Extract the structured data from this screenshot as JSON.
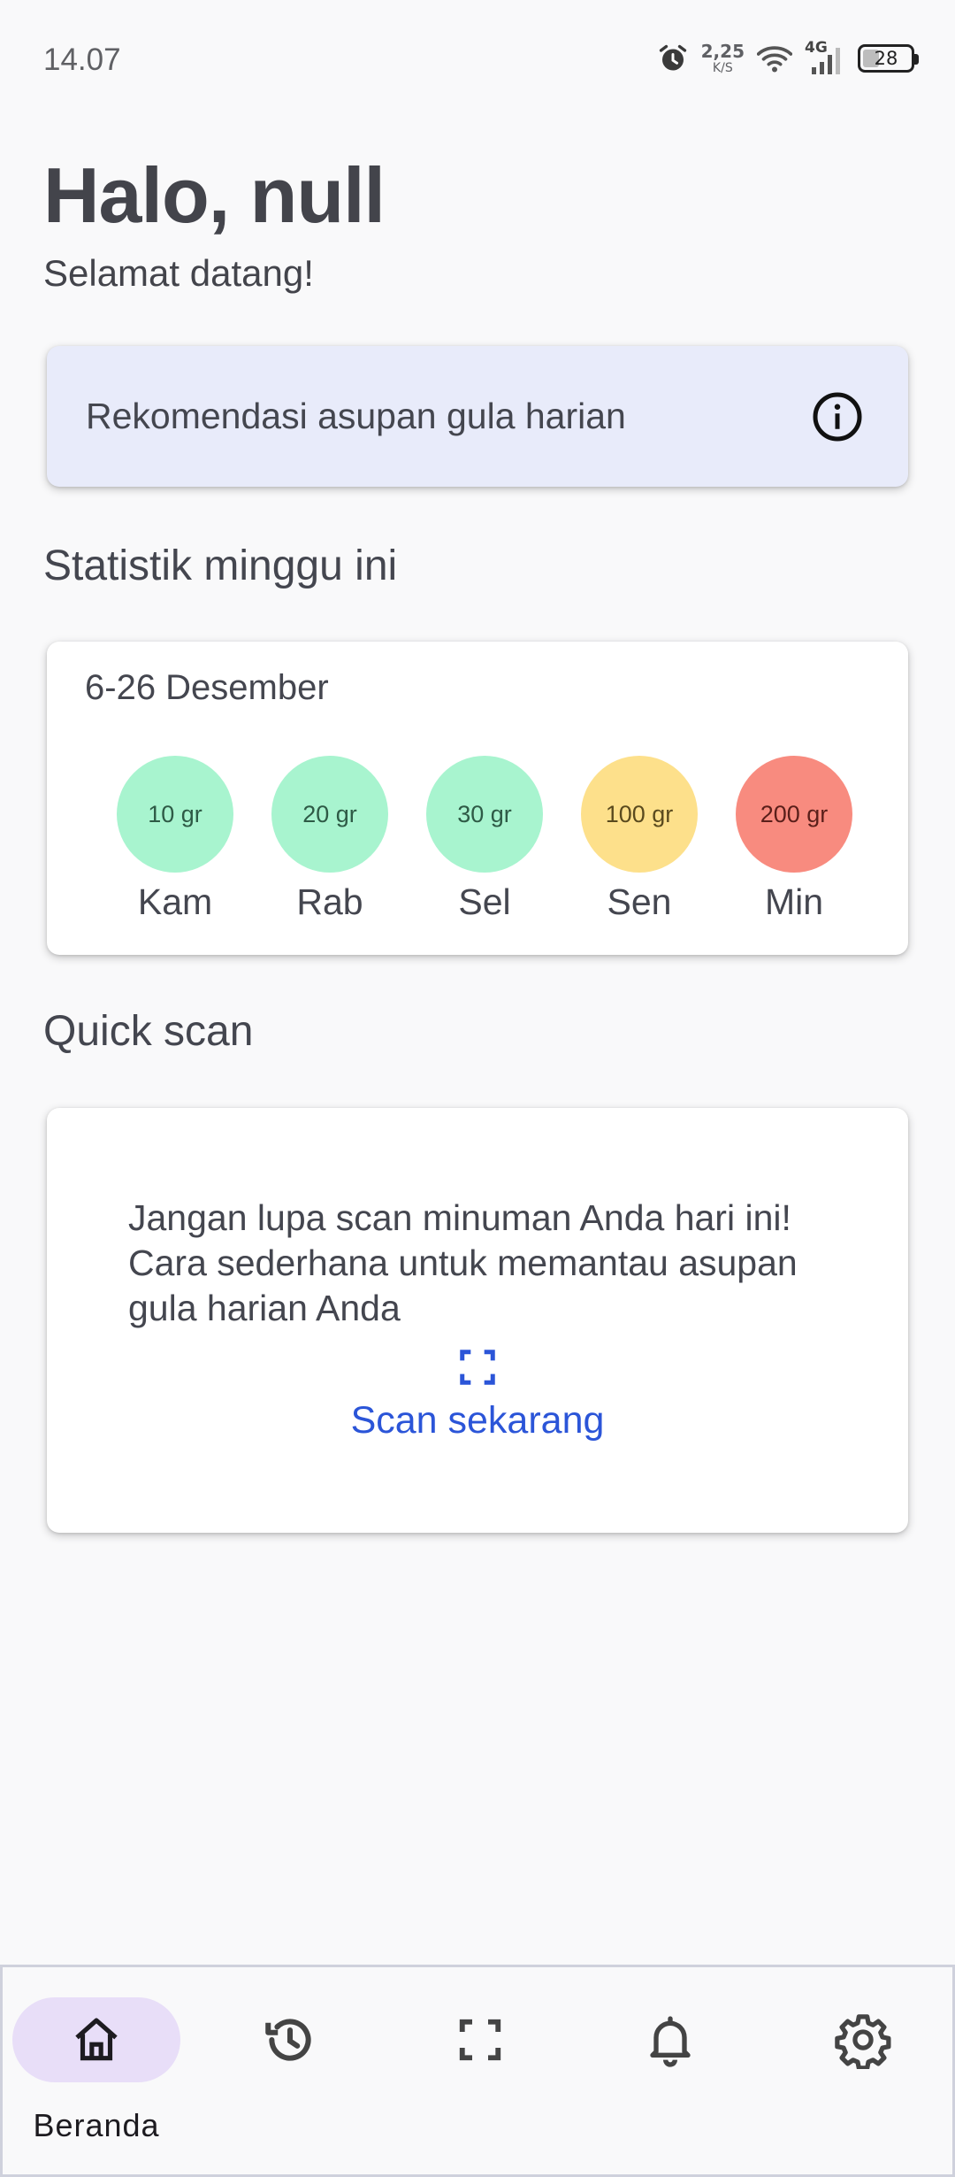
{
  "status_bar": {
    "time": "14.07",
    "speed_value": "2,25",
    "speed_unit": "K/S",
    "network": "4G",
    "battery": "28"
  },
  "header": {
    "greeting": "Halo, null",
    "welcome": "Selamat datang!"
  },
  "recommendation": {
    "text": "Rekomendasi asupan gula harian",
    "icon": "info-icon"
  },
  "stats": {
    "title": "Statistik minggu ini",
    "date_range": "6-26 Desember",
    "days": [
      {
        "amount": "10 gr",
        "label": "Kam",
        "color": "#a8f4cf",
        "text_color": "#2e5a46"
      },
      {
        "amount": "20 gr",
        "label": "Rab",
        "color": "#a8f4cf",
        "text_color": "#2e5a46"
      },
      {
        "amount": "30 gr",
        "label": "Sel",
        "color": "#a8f4cf",
        "text_color": "#2e5a46"
      },
      {
        "amount": "100 gr",
        "label": "Sen",
        "color": "#fde08b",
        "text_color": "#5a4a1e"
      },
      {
        "amount": "200 gr",
        "label": "Min",
        "color": "#f88b7f",
        "text_color": "#5a1f1a"
      }
    ]
  },
  "quick_scan": {
    "title": "Quick scan",
    "message": "Jangan lupa scan minuman Anda hari ini! Cara sederhana untuk memantau asupan gula harian Anda",
    "action": "Scan sekarang",
    "icon": "scan-icon"
  },
  "bottom_nav": {
    "items": [
      {
        "label": "Beranda",
        "icon": "home-icon",
        "active": true
      },
      {
        "label": "",
        "icon": "history-icon",
        "active": false
      },
      {
        "label": "",
        "icon": "scan-icon",
        "active": false
      },
      {
        "label": "",
        "icon": "bell-icon",
        "active": false
      },
      {
        "label": "",
        "icon": "gear-icon",
        "active": false
      }
    ]
  },
  "colors": {
    "accent": "#2b55d8",
    "rec_card_bg": "#e8ebfa",
    "nav_active": "#e8def8"
  }
}
